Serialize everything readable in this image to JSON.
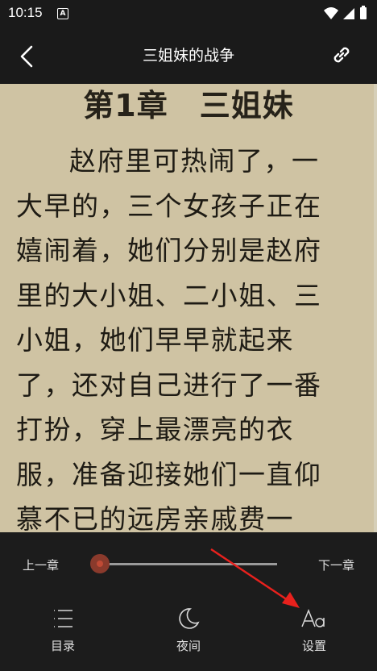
{
  "status_bar": {
    "time": "10:15",
    "notification_letter": "A"
  },
  "app_bar": {
    "title": "三姐妹的战争"
  },
  "reader": {
    "chapter_title": "第1章　三姐妹",
    "paragraph": "赵府里可热闹了，一大早的，三个女孩子正在嬉闹着，她们分别是赵府里的大小姐、二小姐、三小姐，她们早早就起来了，还对自己进行了一番打扮，穿上最漂亮的衣服，准备迎接她们一直仰慕不已的远房亲戚费一帆。"
  },
  "controls": {
    "prev_chapter": "上一章",
    "next_chapter": "下一章",
    "progress": 0
  },
  "bottom_nav": [
    {
      "label": "目录",
      "icon": "list-icon"
    },
    {
      "label": "夜间",
      "icon": "moon-icon"
    },
    {
      "label": "设置",
      "icon": "font-settings-icon"
    }
  ],
  "colors": {
    "page_background": "#cfc3a3",
    "accent": "#c04a35",
    "annotation_arrow": "#e8211d"
  }
}
